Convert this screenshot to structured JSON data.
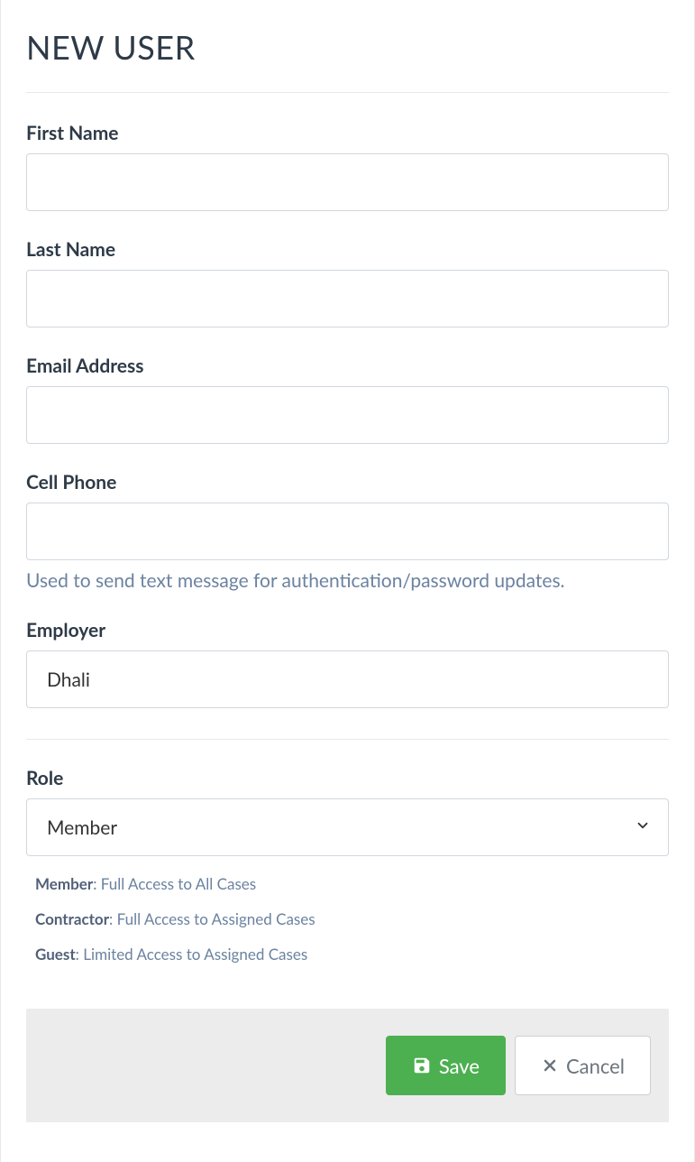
{
  "page_title": "NEW USER",
  "fields": {
    "first_name": {
      "label": "First Name",
      "value": ""
    },
    "last_name": {
      "label": "Last Name",
      "value": ""
    },
    "email": {
      "label": "Email Address",
      "value": ""
    },
    "cell_phone": {
      "label": "Cell Phone",
      "value": "",
      "help": "Used to send text message for authentication/password updates."
    },
    "employer": {
      "label": "Employer",
      "value": "Dhali"
    },
    "role": {
      "label": "Role",
      "selected": "Member"
    }
  },
  "role_descriptions": [
    {
      "name": "Member",
      "text": ": Full Access to All Cases"
    },
    {
      "name": "Contractor",
      "text": ": Full Access to Assigned Cases"
    },
    {
      "name": "Guest",
      "text": ": Limited Access to Assigned Cases"
    }
  ],
  "buttons": {
    "save": "Save",
    "cancel": "Cancel"
  }
}
